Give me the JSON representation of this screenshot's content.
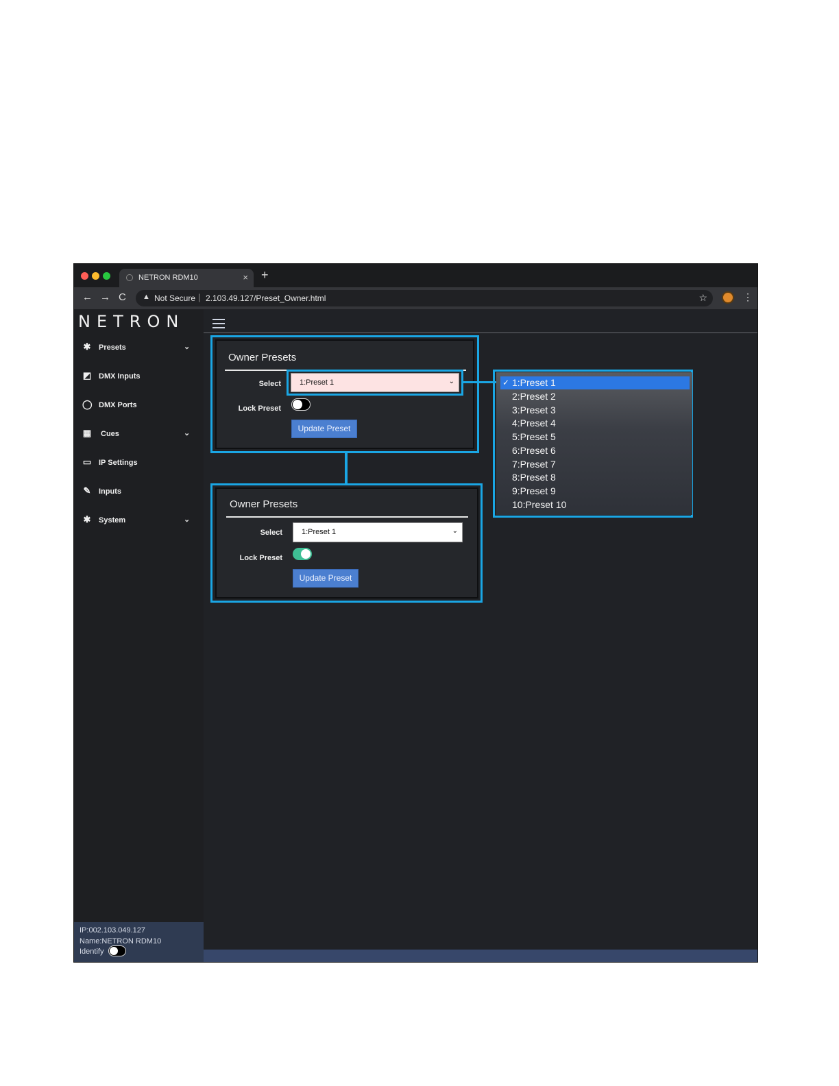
{
  "browser": {
    "tab_title": "NETRON RDM10",
    "tab_close": "×",
    "new_tab": "+",
    "not_secure": "Not Secure",
    "separator": "|",
    "url": "2.103.49.127/Preset_Owner.html",
    "back": "←",
    "forward": "→",
    "reload": "C",
    "warning_icon": "▲",
    "star": "☆",
    "menu": "⋮"
  },
  "logo": "NETRON",
  "sidebar": {
    "items": [
      {
        "label": "Presets",
        "icon": "gear-icon",
        "glyph": "✱",
        "chevron": "⌄"
      },
      {
        "label": "DMX Inputs",
        "icon": "pencil-square-icon",
        "glyph": "◩"
      },
      {
        "label": "DMX Ports",
        "icon": "circle-icon",
        "glyph": "◯"
      },
      {
        "label": "Cues",
        "icon": "film-icon",
        "glyph": "▦",
        "chevron": "⌄"
      },
      {
        "label": "IP Settings",
        "icon": "laptop-icon",
        "glyph": "▭"
      },
      {
        "label": "Inputs",
        "icon": "plug-icon",
        "glyph": "✎"
      },
      {
        "label": "System",
        "icon": "gear-icon",
        "glyph": "✱",
        "chevron": "⌄"
      }
    ],
    "footer": {
      "ip": "IP:002.103.049.127",
      "name": "Name:NETRON RDM10",
      "identify": "Identify"
    }
  },
  "panel_unlocked": {
    "title": "Owner Presets",
    "select_label": "Select",
    "select_value": "1:Preset 1",
    "lock_label": "Lock Preset",
    "lock_on": false,
    "button": "Update Preset"
  },
  "panel_locked": {
    "title": "Owner Presets",
    "select_label": "Select",
    "select_value": "1:Preset 1",
    "lock_label": "Lock Preset",
    "lock_on": true,
    "button": "Update Preset"
  },
  "dropdown": {
    "check": "✓",
    "options": [
      "1:Preset 1",
      "2:Preset 2",
      "3:Preset 3",
      "4:Preset 4",
      "5:Preset 5",
      "6:Preset 6",
      "7:Preset 7",
      "8:Preset 8",
      "9:Preset 9",
      "10:Preset 10"
    ],
    "selected_index": 0
  },
  "colors": {
    "highlight": "#1aa6e4",
    "toggle_on": "#3fbf95",
    "select_highlight_bg": "#fde3e3",
    "selected_option": "#2c78e3"
  }
}
